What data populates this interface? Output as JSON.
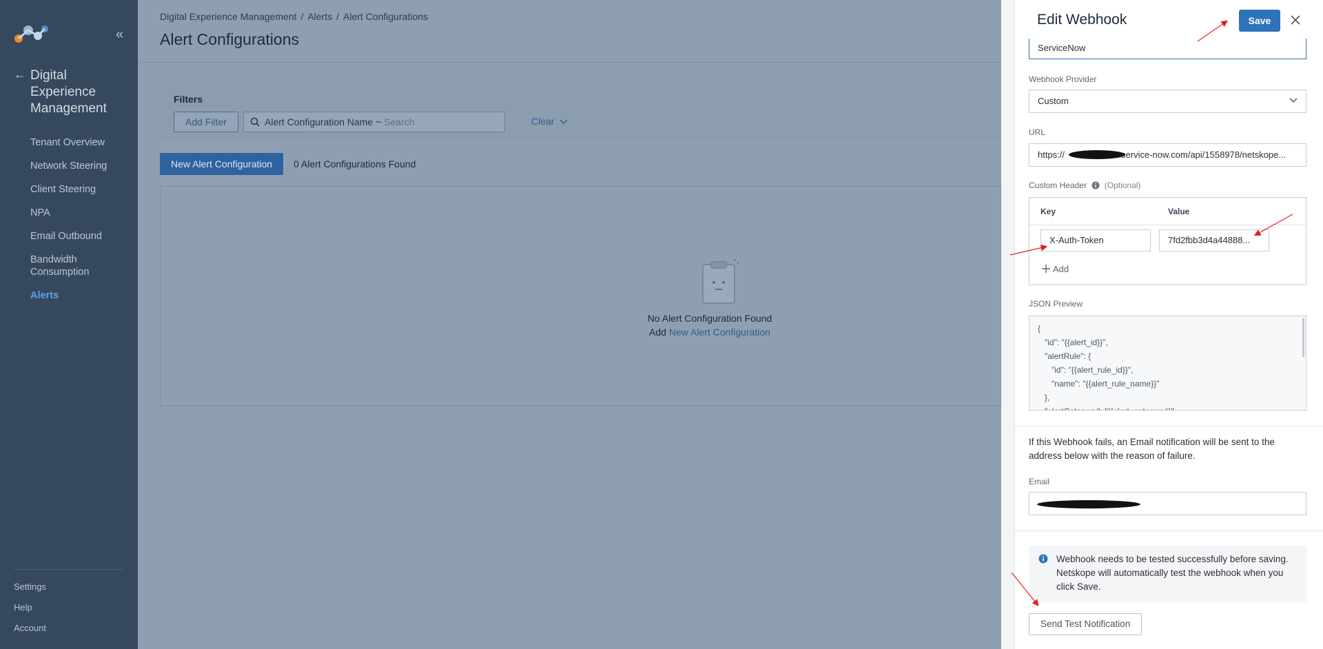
{
  "sidebar": {
    "section_title": "Digital Experience Management",
    "items": [
      {
        "label": "Tenant Overview"
      },
      {
        "label": "Network Steering"
      },
      {
        "label": "Client Steering"
      },
      {
        "label": "NPA"
      },
      {
        "label": "Email Outbound"
      },
      {
        "label": "Bandwidth Consumption"
      },
      {
        "label": "Alerts"
      }
    ],
    "bottom_items": [
      {
        "label": "Settings"
      },
      {
        "label": "Help"
      },
      {
        "label": "Account"
      }
    ]
  },
  "main": {
    "breadcrumb": [
      "Digital Experience Management",
      "Alerts",
      "Alert Configurations"
    ],
    "breadcrumb_sep": "/",
    "title": "Alert Configurations",
    "filters": {
      "label": "Filters",
      "add_filter": "Add Filter",
      "search_field": "Alert Configuration Name ~",
      "search_placeholder": "Search",
      "clear": "Clear"
    },
    "new_button": "New Alert Configuration",
    "count_text": "0 Alert Configurations Found",
    "empty": {
      "title": "No Alert Configuration Found",
      "prefix": "Add",
      "link": "New Alert Configuration"
    }
  },
  "drawer": {
    "title": "Edit Webhook",
    "save": "Save",
    "name_value": "ServiceNow",
    "provider_label": "Webhook Provider",
    "provider_value": "Custom",
    "url_label": "URL",
    "url_prefix": "https://",
    "url_suffix": "service-now.com/api/1558978/netskope...",
    "custom_header_label": "Custom Header",
    "custom_header_optional": "(Optional)",
    "table": {
      "key_header": "Key",
      "value_header": "Value",
      "key_value": "X-Auth-Token",
      "value_value": "7fd2fbb3d4a44888...",
      "add": "Add"
    },
    "json_label": "JSON Preview",
    "json_text": "{\n   \"id\": \"{{alert_id}}\",\n   \"alertRule\": {\n      \"id\": \"{{alert_rule_id}}\",\n      \"name\": \"{{alert_rule_name}}\"\n   },\n   \"alertCategory\": \"{{alert_category}}\",",
    "fail_text": "If this Webhook fails, an Email notification will be sent to the address below with the reason of failure.",
    "email_label": "Email",
    "info_text": "Webhook needs to be tested successfully before saving. Netskope will automatically test the webhook when you click Save.",
    "test_button": "Send Test Notification"
  },
  "colors": {
    "sidebar_bg": "#35485e",
    "accent": "#2f73b8",
    "active_nav": "#5ba4e6",
    "annotation_arrow": "#e02020"
  }
}
